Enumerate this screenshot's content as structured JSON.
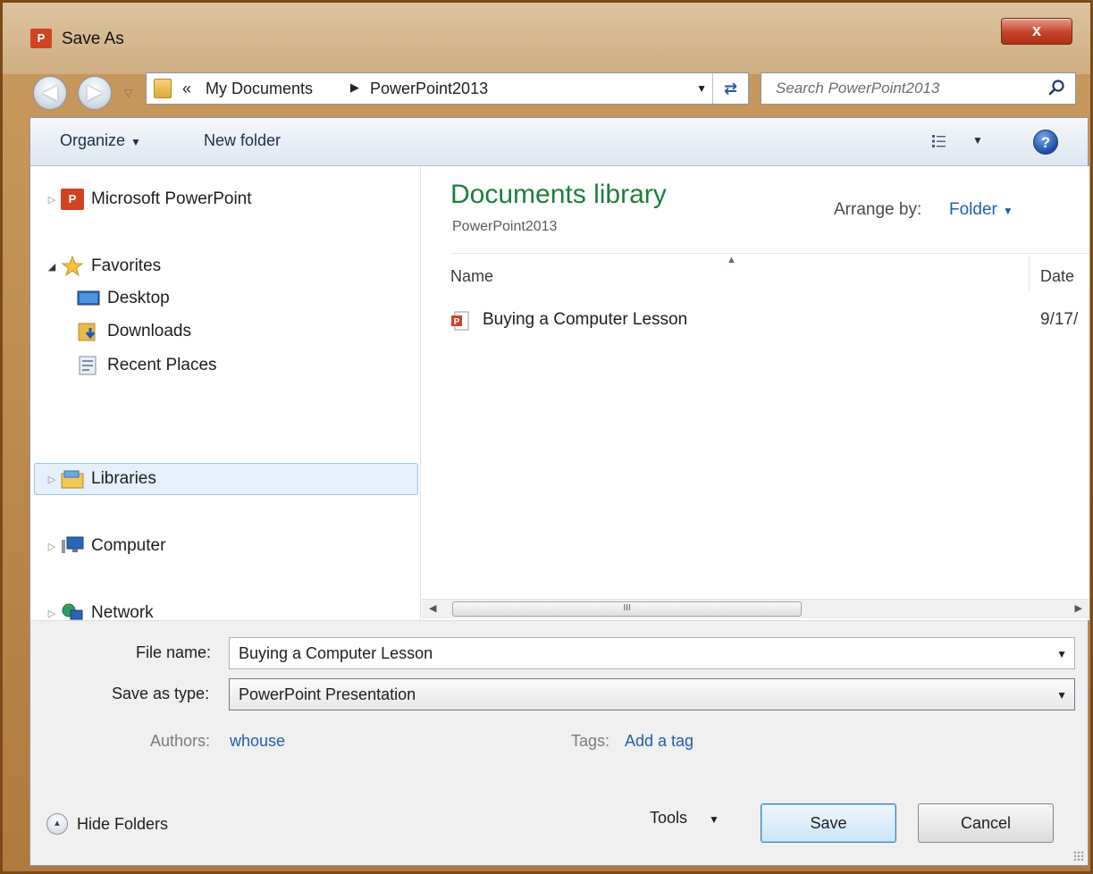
{
  "window": {
    "title": "Save As",
    "app_icon_label": "P",
    "close_label": "x"
  },
  "address": {
    "overflow_glyph": "«",
    "crumbs": [
      "My Documents",
      "PowerPoint2013"
    ]
  },
  "search": {
    "placeholder": "Search PowerPoint2013"
  },
  "toolbar": {
    "organize": "Organize",
    "new_folder": "New folder",
    "help": "?"
  },
  "nav": {
    "items": [
      {
        "label": "Microsoft PowerPoint"
      },
      {
        "label": "Favorites"
      },
      {
        "label": "Desktop"
      },
      {
        "label": "Downloads"
      },
      {
        "label": "Recent Places"
      },
      {
        "label": "Libraries"
      },
      {
        "label": "Computer"
      },
      {
        "label": "Network"
      }
    ]
  },
  "content": {
    "library_title": "Documents library",
    "library_subtitle": "PowerPoint2013",
    "arrange_label": "Arrange by:",
    "arrange_value": "Folder",
    "columns": {
      "name": "Name",
      "date": "Date"
    },
    "files": [
      {
        "name": "Buying a Computer Lesson",
        "date": "9/17/"
      }
    ],
    "scroll_thumb": "III"
  },
  "form": {
    "file_name_label": "File name:",
    "file_name_value": "Buying a Computer Lesson",
    "type_label": "Save as type:",
    "type_value": "PowerPoint Presentation",
    "authors_label": "Authors:",
    "authors_value": "whouse",
    "tags_label": "Tags:",
    "tags_value": "Add a tag"
  },
  "footer": {
    "hide_folders": "Hide Folders",
    "tools": "Tools",
    "save": "Save",
    "cancel": "Cancel"
  },
  "colors": {
    "library_title": "#1c7f3a",
    "link": "#1f5fae",
    "selection": "#e5f0fb",
    "powerpoint": "#d04423"
  }
}
